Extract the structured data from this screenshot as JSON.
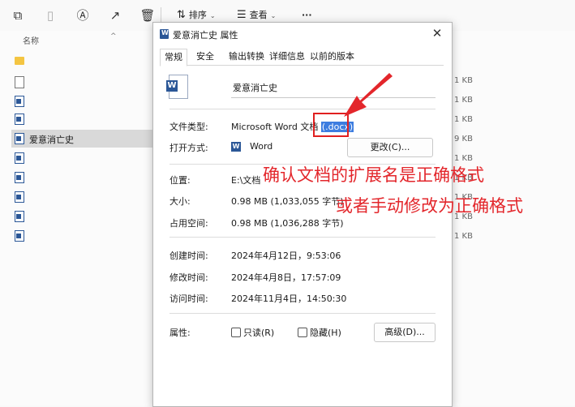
{
  "toolbar": {
    "icons": [
      "copy-icon",
      "paste-icon",
      "rename-icon",
      "share-icon",
      "delete-icon",
      "more-icon"
    ],
    "sort_label": "排序",
    "view_label": "查看",
    "more_label": "···"
  },
  "file_list": {
    "column_name": "名称",
    "selected_name": "爱意消亡史",
    "sizes": [
      "1 KB",
      "1 KB",
      "1 KB",
      "9 KB",
      "1 KB",
      "1 KB",
      "1 KB",
      "1 KB",
      "1 KB",
      "1 KB"
    ]
  },
  "dialog": {
    "title": "爱意消亡史 属性",
    "tabs": [
      "常规",
      "安全",
      "输出转换",
      "详细信息",
      "以前的版本"
    ],
    "file_name": "爱意消亡史",
    "file_type_label": "文件类型:",
    "file_type_value": "Microsoft Word 文档",
    "file_ext": "(.docx)",
    "open_with_label": "打开方式:",
    "open_with_value": "Word",
    "change_button": "更改(C)...",
    "location_label": "位置:",
    "location_value": "E:\\文档",
    "size_label": "大小:",
    "size_value": "0.98 MB (1,033,055 字节)",
    "size_on_disk_label": "占用空间:",
    "size_on_disk_value": "0.98 MB (1,036,288 字节)",
    "created_label": "创建时间:",
    "created_value": "2024年4月12日，9:53:06",
    "modified_label": "修改时间:",
    "modified_value": "2024年4月8日，17:57:09",
    "accessed_label": "访问时间:",
    "accessed_value": "2024年11月4日，14:50:30",
    "attributes_label": "属性:",
    "readonly_label": "只读(R)",
    "hidden_label": "隐藏(H)",
    "advanced_button": "高级(D)..."
  },
  "annotation": {
    "line1": "确认文档的扩展名是正确格式",
    "line2": "或者手动修改为正确格式",
    "color": "#e3262b"
  }
}
